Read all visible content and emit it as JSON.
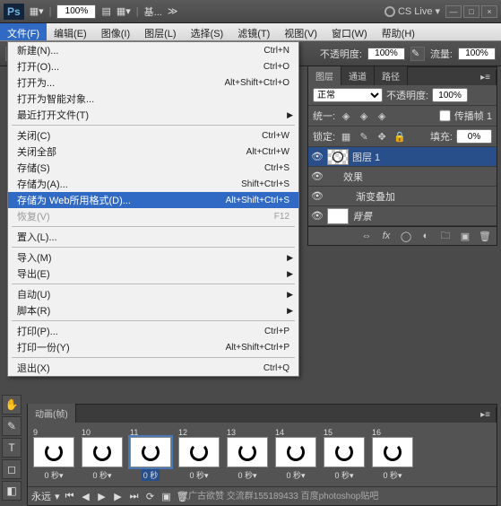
{
  "titlebar": {
    "app": "Ps",
    "zoom": "100%",
    "docname": "基...",
    "cslive": "CS Live"
  },
  "menubar": [
    "文件(F)",
    "编辑(E)",
    "图像(I)",
    "图层(L)",
    "选择(S)",
    "滤镜(T)",
    "视图(V)",
    "窗口(W)",
    "帮助(H)"
  ],
  "optbar": {
    "opacity_label": "不透明度:",
    "opacity": "100%",
    "flow_label": "流量:",
    "flow": "100%"
  },
  "filemenu": [
    {
      "label": "新建(N)...",
      "sc": "Ctrl+N"
    },
    {
      "label": "打开(O)...",
      "sc": "Ctrl+O"
    },
    {
      "label": "打开为...",
      "sc": "Alt+Shift+Ctrl+O"
    },
    {
      "label": "打开为智能对象..."
    },
    {
      "label": "最近打开文件(T)",
      "sub": true
    },
    {
      "sep": true
    },
    {
      "label": "关闭(C)",
      "sc": "Ctrl+W"
    },
    {
      "label": "关闭全部",
      "sc": "Alt+Ctrl+W"
    },
    {
      "label": "存储(S)",
      "sc": "Ctrl+S"
    },
    {
      "label": "存储为(A)...",
      "sc": "Shift+Ctrl+S"
    },
    {
      "label": "存储为 Web所用格式(D)...",
      "sc": "Alt+Shift+Ctrl+S",
      "hl": true
    },
    {
      "label": "恢复(V)",
      "sc": "F12",
      "dis": true
    },
    {
      "sep": true
    },
    {
      "label": "置入(L)..."
    },
    {
      "sep": true
    },
    {
      "label": "导入(M)",
      "sub": true
    },
    {
      "label": "导出(E)",
      "sub": true
    },
    {
      "sep": true
    },
    {
      "label": "自动(U)",
      "sub": true
    },
    {
      "label": "脚本(R)",
      "sub": true
    },
    {
      "sep": true
    },
    {
      "label": "打印(P)...",
      "sc": "Ctrl+P"
    },
    {
      "label": "打印一份(Y)",
      "sc": "Alt+Shift+Ctrl+P"
    },
    {
      "sep": true
    },
    {
      "label": "退出(X)",
      "sc": "Ctrl+Q"
    }
  ],
  "layerspanel": {
    "tabs": [
      "图层",
      "通道",
      "路径"
    ],
    "mode": "正常",
    "opacity_label": "不透明度:",
    "opacity": "100%",
    "unify_label": "统一:",
    "propagate_label": "传播帧 1",
    "lock_label": "锁定:",
    "fill_label": "填充:",
    "fill": "0%",
    "layers": [
      {
        "name": "图层 1",
        "sel": true,
        "circle": true
      },
      {
        "name": "效果",
        "fx": true,
        "indent": 1
      },
      {
        "name": "渐变叠加",
        "fx": true,
        "indent": 2
      },
      {
        "name": "背景",
        "bg": true
      }
    ]
  },
  "anim": {
    "title": "动画(帧)",
    "frames": [
      {
        "n": "9",
        "d": "0 秒▾"
      },
      {
        "n": "10",
        "d": "0 秒▾"
      },
      {
        "n": "11",
        "d": "0 秒",
        "sel": true
      },
      {
        "n": "12",
        "d": "0 秒▾"
      },
      {
        "n": "13",
        "d": "0 秒▾"
      },
      {
        "n": "14",
        "d": "0 秒▾"
      },
      {
        "n": "15",
        "d": "0 秒▾"
      },
      {
        "n": "16",
        "d": "0 秒▾"
      }
    ],
    "loop": "永远"
  },
  "watermark": "汉广古欲赞   交流群155189433   百度photoshop贴吧"
}
